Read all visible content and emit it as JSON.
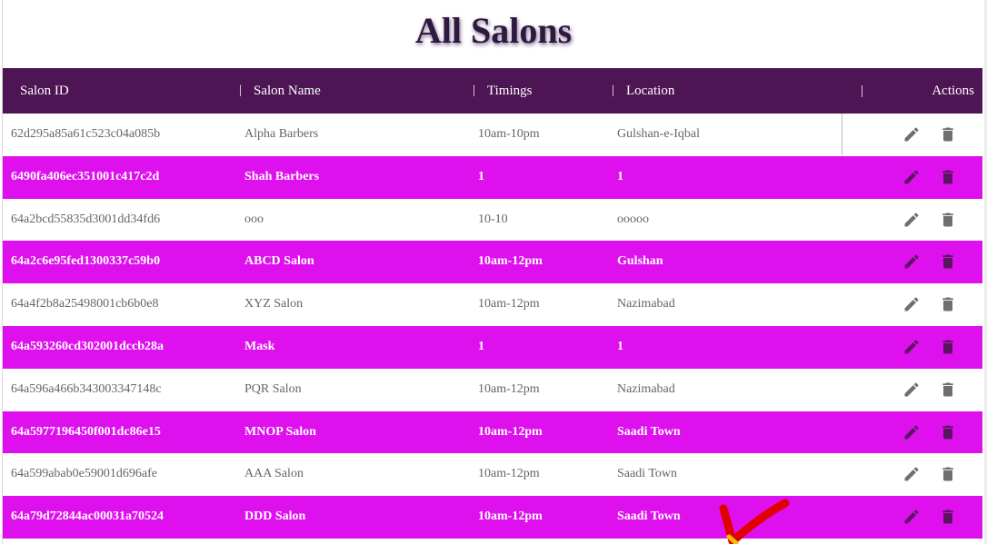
{
  "page": {
    "title": "All Salons"
  },
  "table": {
    "headers": {
      "id": "Salon ID",
      "name": "Salon Name",
      "timings": "Timings",
      "location": "Location",
      "actions": "Actions"
    },
    "rows": [
      {
        "id": "62d295a85a61c523c04a085b",
        "name": "Alpha Barbers",
        "timings": "10am-10pm",
        "location": "Gulshan-e-Iqbal"
      },
      {
        "id": "6490fa406ec351001c417c2d",
        "name": "Shah Barbers",
        "timings": "1",
        "location": "1"
      },
      {
        "id": "64a2bcd55835d3001dd34fd6",
        "name": "ooo",
        "timings": "10-10",
        "location": "ooooo"
      },
      {
        "id": "64a2c6e95fed1300337c59b0",
        "name": "ABCD Salon",
        "timings": "10am-12pm",
        "location": "Gulshan"
      },
      {
        "id": "64a4f2b8a25498001cb6b0e8",
        "name": "XYZ Salon",
        "timings": "10am-12pm",
        "location": "Nazimabad"
      },
      {
        "id": "64a593260cd302001dccb28a",
        "name": "Mask",
        "timings": "1",
        "location": "1"
      },
      {
        "id": "64a596a466b343003347148c",
        "name": "PQR Salon",
        "timings": "10am-12pm",
        "location": "Nazimabad"
      },
      {
        "id": "64a5977196450f001dc86e15",
        "name": "MNOP Salon",
        "timings": "10am-12pm",
        "location": "Saadi Town"
      },
      {
        "id": "64a599abab0e59001d696afe",
        "name": "AAA Salon",
        "timings": "10am-12pm",
        "location": "Saadi Town"
      },
      {
        "id": "64a79d72844ac00031a70524",
        "name": "DDD Salon",
        "timings": "10am-12pm",
        "location": "Saadi Town"
      }
    ],
    "row_actions": [
      "edit-icon",
      "delete-icon"
    ]
  },
  "colors": {
    "header_bg": "#4e1554",
    "accent_row_bg": "#de10ee",
    "plain_row_bg": "#ffffff",
    "plain_text": "#666666",
    "annotation_red": "#e00000"
  }
}
